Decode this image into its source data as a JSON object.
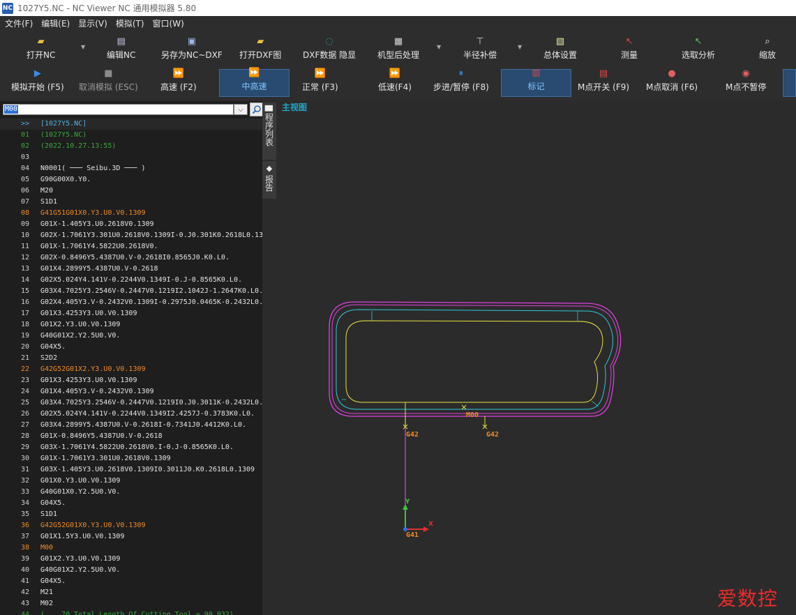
{
  "window": {
    "title": "1027Y5.NC - NC Viewer NC 通用模拟器 5.80",
    "app_icon": "NC"
  },
  "menu": [
    "文件(F)",
    "编辑(E)",
    "显示(V)",
    "模拟(T)",
    "窗口(W)"
  ],
  "toolbar_top": [
    {
      "label": "打开NC",
      "icon": "folder-open-icon"
    },
    {
      "label": "编辑NC",
      "icon": "edit-icon"
    },
    {
      "label": "另存为NC~DXF",
      "icon": "save-icon"
    },
    {
      "label": "打开DXF图",
      "icon": "open-dxf-icon"
    },
    {
      "label": "DXF数据 隐显",
      "icon": "dxf-toggle-icon"
    },
    {
      "label": "机型后处理",
      "icon": "post-process-icon"
    },
    {
      "label": "半径补偿",
      "icon": "radius-comp-icon"
    },
    {
      "label": "总体设置",
      "icon": "settings-icon"
    },
    {
      "label": "测量",
      "icon": "measure-icon"
    },
    {
      "label": "选取分析",
      "icon": "select-analyze-icon"
    },
    {
      "label": "缩放",
      "icon": "zoom-icon"
    }
  ],
  "toolbar_sim": [
    {
      "label": "模拟开始 (F5)",
      "icon": "play-icon",
      "state": "normal"
    },
    {
      "label": "取消模拟 (ESC)",
      "icon": "stop-icon",
      "state": "disabled"
    },
    {
      "label": "高速 (F2)",
      "icon": "fast-forward-icon",
      "state": "normal"
    },
    {
      "label": "中高速",
      "icon": "fast-forward-icon",
      "state": "active"
    },
    {
      "label": "正常 (F3)",
      "icon": "fast-forward-icon",
      "state": "normal"
    },
    {
      "label": "低速(F4)",
      "icon": "fast-forward-icon",
      "state": "normal"
    },
    {
      "label": "步进/暂停 (F8)",
      "icon": "pause-icon",
      "state": "normal"
    },
    {
      "label": "标记",
      "icon": "mark-icon",
      "state": "active"
    },
    {
      "label": "M点开关 (F9)",
      "icon": "m-point-toggle-icon",
      "state": "normal"
    },
    {
      "label": "M点取消 (F6)",
      "icon": "m-point-cancel-icon",
      "state": "normal"
    },
    {
      "label": "M点不暂停",
      "icon": "m-point-nopause-icon",
      "state": "normal"
    }
  ],
  "search": {
    "value": "M00"
  },
  "code": {
    "header_marker": ">>",
    "header_text": "[1027Y5.NC]",
    "lines": [
      {
        "n": "01",
        "t": "(1027Y5.NC)",
        "s": "comment"
      },
      {
        "n": "02",
        "t": "(2022.10.27.13:55)",
        "s": "comment"
      },
      {
        "n": "03",
        "t": "",
        "s": ""
      },
      {
        "n": "04",
        "t": "N0001( ─── Seibu.3D ─── )",
        "s": ""
      },
      {
        "n": "05",
        "t": "G90G00X0.Y0.",
        "s": ""
      },
      {
        "n": "06",
        "t": "M20",
        "s": ""
      },
      {
        "n": "07",
        "t": "S1D1",
        "s": ""
      },
      {
        "n": "08",
        "t": "G41G51G01X0.Y3.U0.V0.1309",
        "s": "orange"
      },
      {
        "n": "09",
        "t": "G01X-1.405Y3.U0.2618V0.1309",
        "s": ""
      },
      {
        "n": "10",
        "t": "G02X-1.7061Y3.301U0.2618V0.1309I-0.J0.301K0.2618L0.13",
        "s": ""
      },
      {
        "n": "11",
        "t": "G01X-1.7061Y4.5822U0.2618V0.",
        "s": ""
      },
      {
        "n": "12",
        "t": "G02X-0.8496Y5.4387U0.V-0.2618I0.8565J0.K0.L0.",
        "s": ""
      },
      {
        "n": "13",
        "t": "G01X4.2899Y5.4387U0.V-0.2618",
        "s": ""
      },
      {
        "n": "14",
        "t": "G02X5.024Y4.141V-0.2244V0.1349I-0.J-0.8565K0.L0.",
        "s": ""
      },
      {
        "n": "15",
        "t": "G03X4.7025Y3.2546V-0.2447V0.1219I2.1042J-1.2647K0.L0.",
        "s": ""
      },
      {
        "n": "16",
        "t": "G02X4.405Y3.V-0.2432V0.1309I-0.2975J0.0465K-0.2432L0.",
        "s": ""
      },
      {
        "n": "17",
        "t": "G01X3.4253Y3.U0.V0.1309",
        "s": ""
      },
      {
        "n": "18",
        "t": "G01X2.Y3.U0.V0.1309",
        "s": ""
      },
      {
        "n": "19",
        "t": "G40G01X2.Y2.5U0.V0.",
        "s": ""
      },
      {
        "n": "20",
        "t": "G04X5.",
        "s": ""
      },
      {
        "n": "21",
        "t": "S2D2",
        "s": ""
      },
      {
        "n": "22",
        "t": "G42G52G01X2.Y3.U0.V0.1309",
        "s": "orange"
      },
      {
        "n": "23",
        "t": "G01X3.4253Y3.U0.V0.1309",
        "s": ""
      },
      {
        "n": "24",
        "t": "G01X4.405Y3.V-0.2432V0.1309",
        "s": ""
      },
      {
        "n": "25",
        "t": "G03X4.7025Y3.2546V-0.2447V0.1219I0.J0.3011K-0.2432L0.",
        "s": ""
      },
      {
        "n": "26",
        "t": "G02X5.024Y4.141V-0.2244V0.1349I2.4257J-0.3783K0.L0.",
        "s": ""
      },
      {
        "n": "27",
        "t": "G03X4.2899Y5.4387U0.V-0.2618I-0.7341J0.4412K0.L0.",
        "s": ""
      },
      {
        "n": "28",
        "t": "G01X-0.8496Y5.4387U0.V-0.2618",
        "s": ""
      },
      {
        "n": "29",
        "t": "G03X-1.7061Y4.5822U0.2618V0.I-0.J-0.8565K0.L0.",
        "s": ""
      },
      {
        "n": "30",
        "t": "G01X-1.7061Y3.301U0.2618V0.1309",
        "s": ""
      },
      {
        "n": "31",
        "t": "G03X-1.405Y3.U0.2618V0.1309I0.3011J0.K0.2618L0.1309",
        "s": ""
      },
      {
        "n": "32",
        "t": "G01X0.Y3.U0.V0.1309",
        "s": ""
      },
      {
        "n": "33",
        "t": "G40G01X0.Y2.5U0.V0.",
        "s": ""
      },
      {
        "n": "34",
        "t": "G04X5.",
        "s": ""
      },
      {
        "n": "35",
        "t": "S1D1",
        "s": ""
      },
      {
        "n": "36",
        "t": "G42G52G01X0.Y3.U0.V0.1309",
        "s": "orange"
      },
      {
        "n": "37",
        "t": "G01X1.5Y3.U0.V0.1309",
        "s": ""
      },
      {
        "n": "38",
        "t": "M00",
        "s": "orange"
      },
      {
        "n": "39",
        "t": "G01X2.Y3.U0.V0.1309",
        "s": ""
      },
      {
        "n": "40",
        "t": "G40G01X2.Y2.5U0.V0.",
        "s": ""
      },
      {
        "n": "41",
        "t": "G04X5.",
        "s": ""
      },
      {
        "n": "42",
        "t": "M21",
        "s": ""
      },
      {
        "n": "43",
        "t": "M02",
        "s": ""
      },
      {
        "n": "44",
        "t": "(... 70 Total Length Of Cutting Tool = 90.932)",
        "s": "comment"
      }
    ]
  },
  "side_tabs": [
    {
      "label": "程序列表",
      "icon": "document-icon"
    },
    {
      "label": "报告",
      "icon": "layers-icon"
    }
  ],
  "viewport": {
    "title": "主视图",
    "labels": {
      "g42_a": "G42",
      "g42_b": "G42",
      "m00": "M00",
      "g41": "G41",
      "axis_x": "X",
      "axis_y": "Y"
    },
    "colors": {
      "outer": "#e040e0",
      "cyan": "#30c8d8",
      "yellow": "#e6e040",
      "lead": "#e040e0",
      "label": "#f08a28"
    }
  },
  "watermark": "爱数控"
}
